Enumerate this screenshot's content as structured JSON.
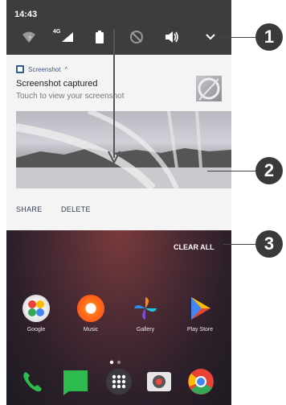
{
  "statusbar": {
    "time": "14:43",
    "network_label": "4G"
  },
  "notification": {
    "app_name": "Screenshot",
    "expand_glyph": "^",
    "title": "Screenshot captured",
    "subtitle": "Touch to view your screenshot",
    "actions": [
      "SHARE",
      "DELETE"
    ]
  },
  "recents": {
    "clear_all_label": "CLEAR ALL"
  },
  "home_apps": [
    {
      "label": "Google",
      "icon": "google-folder-icon"
    },
    {
      "label": "Music",
      "icon": "music-icon"
    },
    {
      "label": "Gallery",
      "icon": "gallery-icon"
    },
    {
      "label": "Play Store",
      "icon": "play-store-icon"
    }
  ],
  "dock": [
    "phone-icon",
    "messages-icon",
    "app-drawer-icon",
    "camera-icon",
    "chrome-icon"
  ],
  "callouts": [
    "1",
    "2",
    "3"
  ],
  "colors": {
    "statusbar": "#3d3d3d",
    "shade": "#f4f4f4",
    "callout": "#3a3a3a"
  }
}
